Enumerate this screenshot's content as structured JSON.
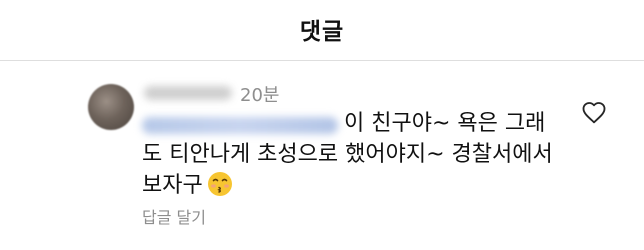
{
  "header": {
    "title": "댓글"
  },
  "comment": {
    "time_ago": "20분",
    "text_lines": [
      "이 친구야~ 욕은 그래",
      "도 티안나게 초성으로 했어야지~ 경찰서에서",
      "보자구"
    ],
    "emoji": "kissing-face",
    "reply_label": "답글 달기"
  },
  "icons": {
    "like": "heart-outline-icon"
  }
}
